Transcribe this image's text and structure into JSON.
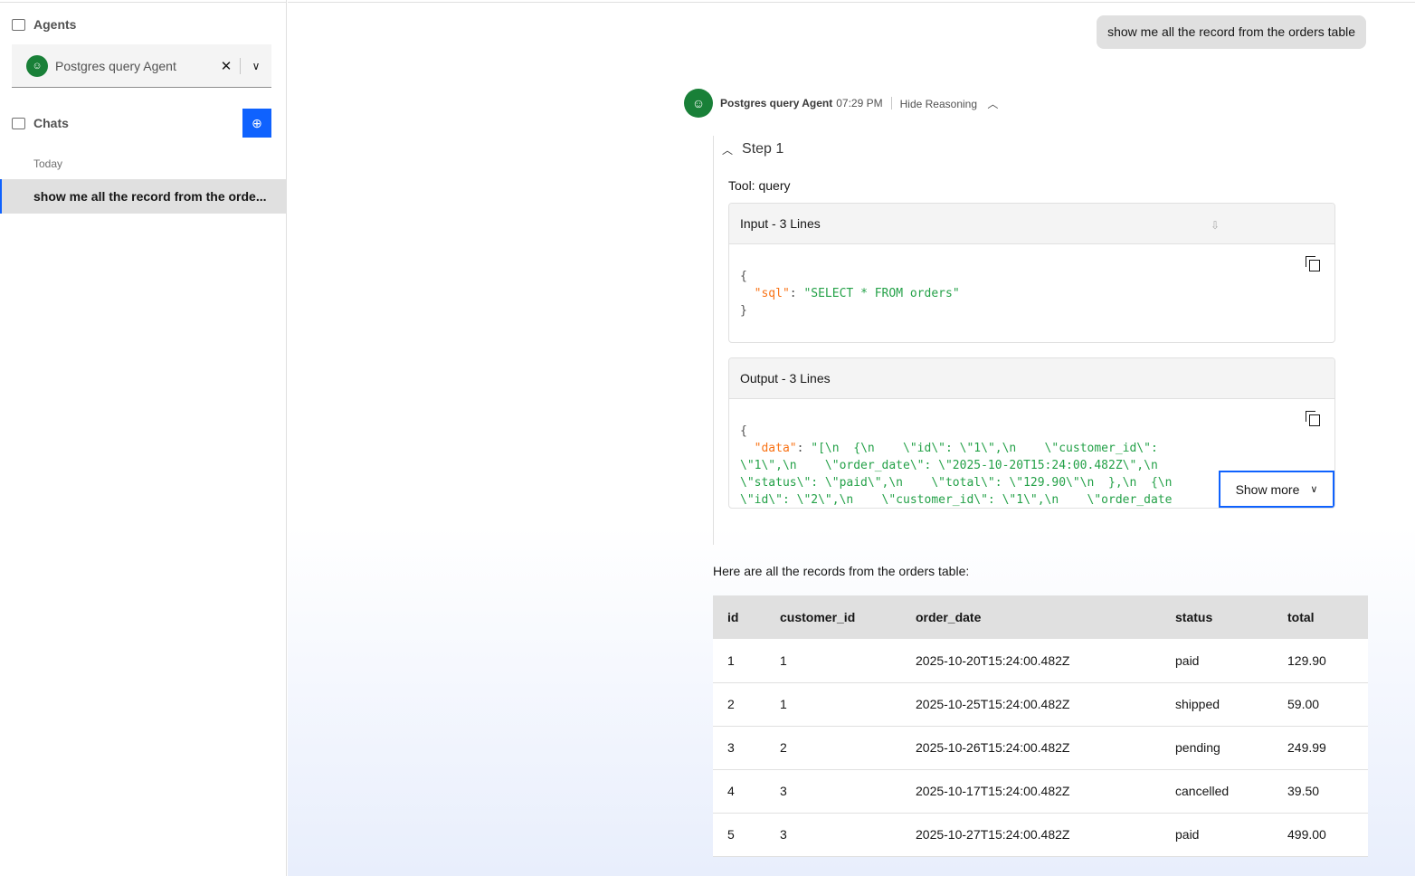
{
  "sidebar": {
    "agents_label": "Agents",
    "selected_agent": "Postgres query Agent",
    "chats_label": "Chats",
    "today_label": "Today",
    "chat_items": [
      {
        "label": "show me all the record from the orde..."
      }
    ]
  },
  "chat": {
    "user_message": "show me all the record from the orders table",
    "agent_name": "Postgres query Agent",
    "time": "07:29 PM",
    "hide_reasoning": "Hide Reasoning",
    "step_label": "Step 1",
    "tool_label": "Tool: query",
    "input_header": "Input - 3 Lines",
    "input_key": "\"sql\"",
    "input_value": "\"SELECT * FROM orders\"",
    "output_header": "Output - 3 Lines",
    "output_key": "\"data\"",
    "output_lines": [
      "\"[\\n  {\\n    \\\"id\\\": \\\"1\\\",\\n    \\\"customer_id\\\":",
      "\\\"1\\\",\\n    \\\"order_date\\\": \\\"2025-10-20T15:24:00.482Z\\\",\\n",
      "\\\"status\\\": \\\"paid\\\",\\n    \\\"total\\\": \\\"129.90\\\"\\n  },\\n  {\\n",
      "\\\"id\\\": \\\"2\\\",\\n    \\\"customer_id\\\": \\\"1\\\",\\n    \\\"order_date"
    ],
    "show_more": "Show more",
    "summary": "Here are all the records from the orders table:",
    "table": {
      "headers": [
        "id",
        "customer_id",
        "order_date",
        "status",
        "total"
      ],
      "rows": [
        [
          "1",
          "1",
          "2025-10-20T15:24:00.482Z",
          "paid",
          "129.90"
        ],
        [
          "2",
          "1",
          "2025-10-25T15:24:00.482Z",
          "shipped",
          "59.00"
        ],
        [
          "3",
          "2",
          "2025-10-26T15:24:00.482Z",
          "pending",
          "249.99"
        ],
        [
          "4",
          "3",
          "2025-10-17T15:24:00.482Z",
          "cancelled",
          "39.50"
        ],
        [
          "5",
          "3",
          "2025-10-27T15:24:00.482Z",
          "paid",
          "499.00"
        ]
      ]
    }
  },
  "colors": {
    "accent": "#0f62fe",
    "agent_avatar": "#198038",
    "json_key": "#f97316",
    "json_string": "#24a148"
  }
}
